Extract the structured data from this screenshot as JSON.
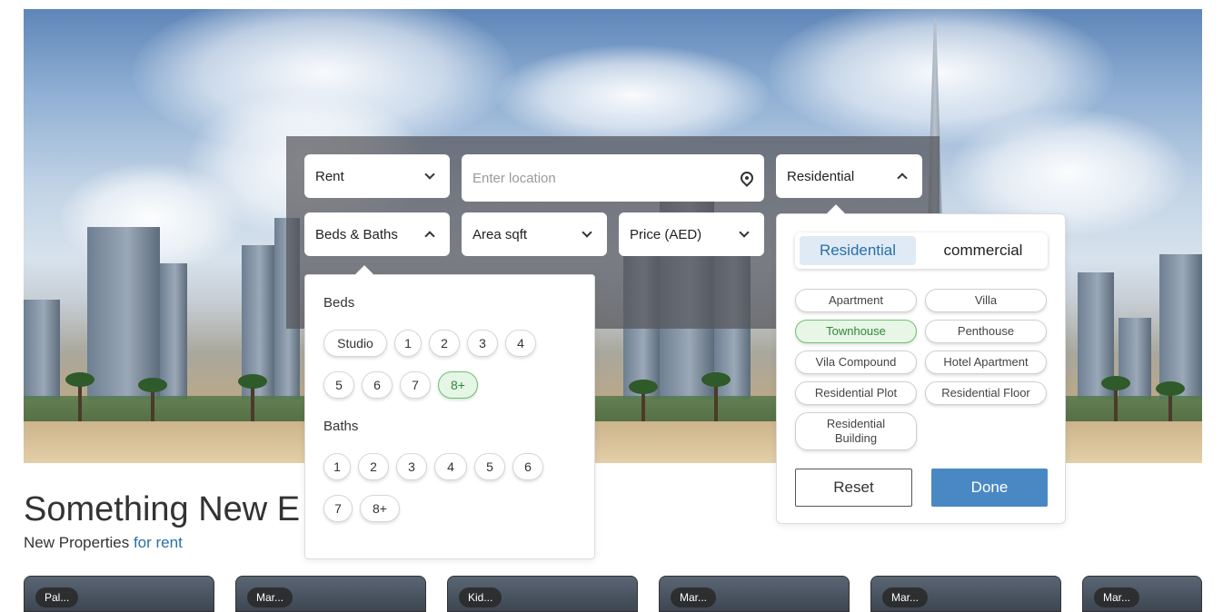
{
  "search": {
    "listing_type": "Rent",
    "location_placeholder": "Enter location",
    "property_category": "Residential",
    "beds_baths_label": "Beds & Baths",
    "area_label": "Area sqft",
    "price_label": "Price (AED)"
  },
  "beds_baths_dropdown": {
    "beds_title": "Beds",
    "beds_options": [
      "Studio",
      "1",
      "2",
      "3",
      "4",
      "5",
      "6",
      "7",
      "8+"
    ],
    "beds_selected": "8+",
    "baths_title": "Baths",
    "baths_options": [
      "1",
      "2",
      "3",
      "4",
      "5",
      "6",
      "7",
      "8+"
    ]
  },
  "property_type_dropdown": {
    "tabs": [
      "Residential",
      "commercial"
    ],
    "active_tab": "Residential",
    "types": [
      "Apartment",
      "Villa",
      "Townhouse",
      "Penthouse",
      "Vila Compound",
      "Hotel Apartment",
      "Residential Plot",
      "Residential Floor",
      "Residential Building"
    ],
    "selected_type": "Townhouse",
    "reset_label": "Reset",
    "done_label": "Done"
  },
  "section": {
    "title": "Something New E",
    "subtitle_prefix": "New Properties",
    "subtitle_link": "for rent"
  },
  "cards": [
    {
      "tag": "Pal..."
    },
    {
      "tag": "Mar..."
    },
    {
      "tag": "Kid..."
    },
    {
      "tag": "Mar..."
    },
    {
      "tag": "Mar..."
    },
    {
      "tag": "Mar..."
    }
  ],
  "colors": {
    "accent": "#2a6fa8",
    "done_button": "#4a88c4",
    "selected_chip": "#e5f5e6",
    "selected_chip_border": "#6cc070"
  }
}
